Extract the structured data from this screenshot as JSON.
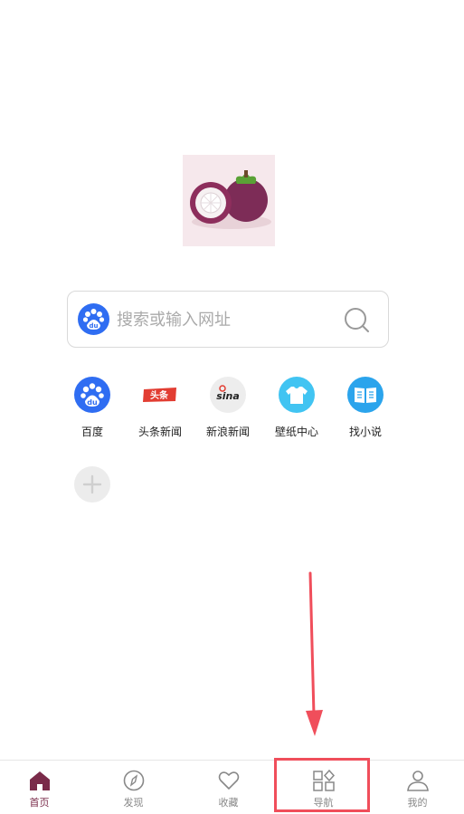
{
  "search": {
    "placeholder": "搜索或输入网址"
  },
  "shortcuts": [
    {
      "label": "百度",
      "icon": "baidu-paw-icon",
      "color": "#2f6df2"
    },
    {
      "label": "头条新闻",
      "icon": "toutiao-logo-icon",
      "color": "#e23d32",
      "badge": "头条"
    },
    {
      "label": "新浪新闻",
      "icon": "sina-logo-icon",
      "color": "#ededed",
      "badge": "sina"
    },
    {
      "label": "壁纸中心",
      "icon": "tshirt-icon",
      "color": "#41c4f2"
    },
    {
      "label": "找小说",
      "icon": "open-book-icon",
      "color": "#2ba4ec"
    }
  ],
  "tabs": [
    {
      "label": "首页",
      "icon": "home-icon",
      "active": true
    },
    {
      "label": "发现",
      "icon": "compass-icon"
    },
    {
      "label": "收藏",
      "icon": "heart-icon"
    },
    {
      "label": "导航",
      "icon": "grid-nav-icon"
    },
    {
      "label": "我的",
      "icon": "person-icon"
    }
  ],
  "colors": {
    "accent": "#7a2b4a",
    "annotation": "#f04e5b"
  }
}
